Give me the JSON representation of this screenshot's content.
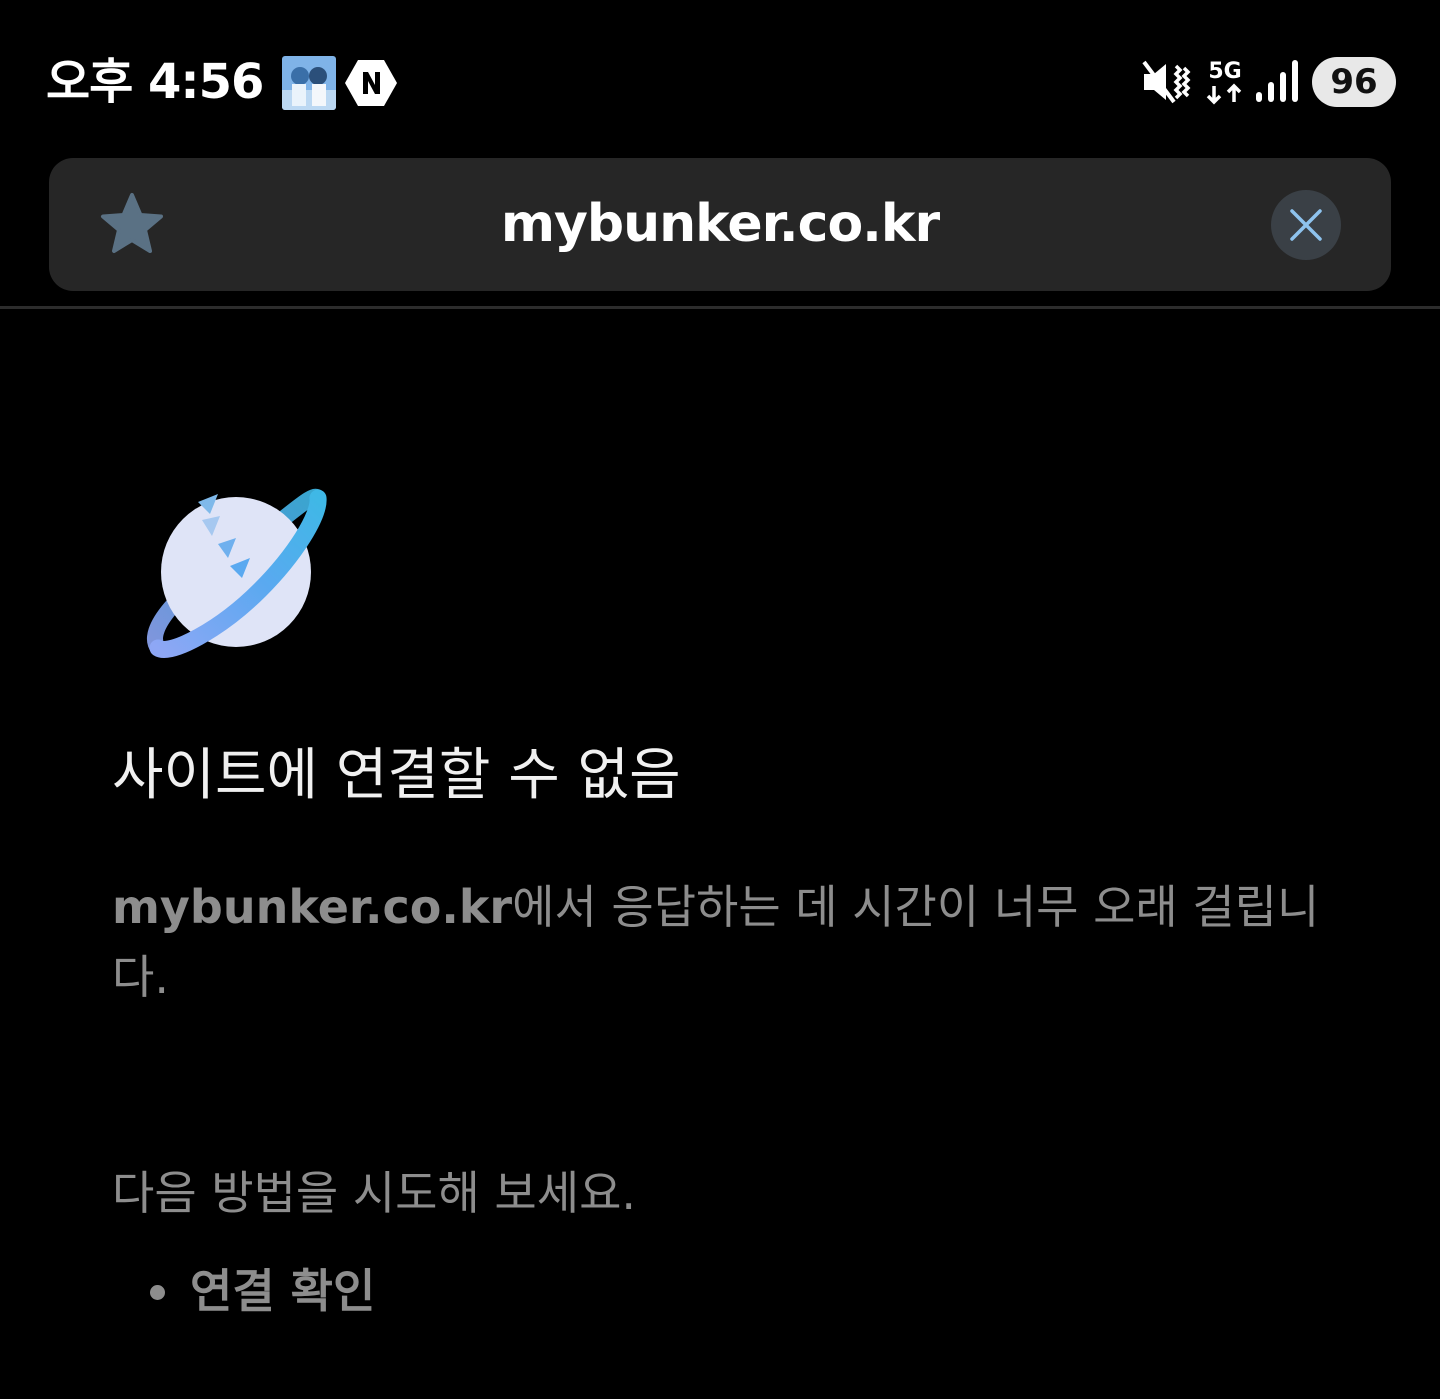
{
  "status_bar": {
    "time": "오후 4:56",
    "network": "5G",
    "battery": "96",
    "icons": [
      "app-thumbnail-icon",
      "naver-icon",
      "vibrate-mute-icon",
      "5g-data-icon",
      "signal-icon"
    ]
  },
  "url_bar": {
    "url": "mybunker.co.kr",
    "bookmark_icon": "star-icon",
    "close_icon": "close-icon"
  },
  "error_page": {
    "icon": "planet-icon",
    "title": "사이트에 연결할 수 없음",
    "description_host": "mybunker.co.kr",
    "description_rest": "에서 응답하는 데 시간이 너무 오래 걸립니다.",
    "suggestions_heading": "다음 방법을 시도해 보세요.",
    "suggestions": [
      {
        "label": "연결 확인"
      }
    ]
  },
  "colors": {
    "background": "#000000",
    "url_bar_bg": "#262626",
    "primary_text": "#f0f0f0",
    "secondary_text": "#8d8d8d",
    "bookmark_star": "#5a7184",
    "close_accent": "#8ec3ee",
    "planet_body": "#dfe4f7",
    "planet_ring": "#5aa9f0"
  }
}
